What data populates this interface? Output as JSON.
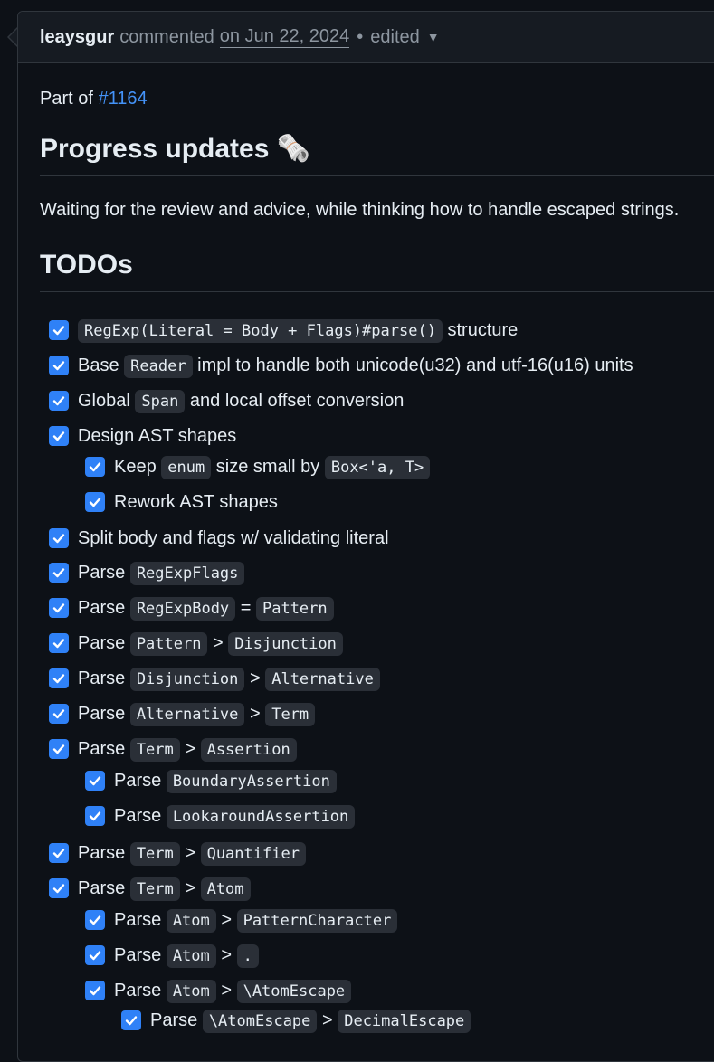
{
  "header": {
    "author": "leaysgur",
    "action": "commented",
    "date": "on Jun 22, 2024",
    "edited": "edited"
  },
  "intro": {
    "prefix": "Part of",
    "issue": "#1164"
  },
  "progress": {
    "heading": "Progress updates",
    "emoji": "🗞️",
    "text": "Waiting for the review and advice, while thinking how to handle escaped strings."
  },
  "todos_heading": "TODOs",
  "todos": [
    {
      "level": 0,
      "checked": true,
      "parts": [
        {
          "c": "RegExp(Literal = Body + Flags)#parse()"
        },
        {
          "t": "structure"
        }
      ]
    },
    {
      "level": 0,
      "checked": true,
      "parts": [
        {
          "t": "Base"
        },
        {
          "c": "Reader"
        },
        {
          "t": "impl to handle both unicode(u32) and utf-16(u16) units"
        }
      ]
    },
    {
      "level": 0,
      "checked": true,
      "parts": [
        {
          "t": "Global"
        },
        {
          "c": "Span"
        },
        {
          "t": "and local offset conversion"
        }
      ]
    },
    {
      "level": 0,
      "checked": true,
      "parts": [
        {
          "t": "Design AST shapes"
        }
      ]
    },
    {
      "level": 1,
      "checked": true,
      "parts": [
        {
          "t": "Keep"
        },
        {
          "c": "enum"
        },
        {
          "t": "size small by"
        },
        {
          "c": "Box<'a, T>"
        }
      ]
    },
    {
      "level": 1,
      "checked": true,
      "parts": [
        {
          "t": "Rework AST shapes"
        }
      ]
    },
    {
      "level": 0,
      "checked": true,
      "parts": [
        {
          "t": "Split body and flags w/ validating literal"
        }
      ]
    },
    {
      "level": 0,
      "checked": true,
      "parts": [
        {
          "t": "Parse"
        },
        {
          "c": "RegExpFlags"
        }
      ]
    },
    {
      "level": 0,
      "checked": true,
      "parts": [
        {
          "t": "Parse"
        },
        {
          "c": "RegExpBody"
        },
        {
          "t": "="
        },
        {
          "c": "Pattern"
        }
      ]
    },
    {
      "level": 0,
      "checked": true,
      "parts": [
        {
          "t": "Parse"
        },
        {
          "c": "Pattern"
        },
        {
          "t": ">"
        },
        {
          "c": "Disjunction"
        }
      ]
    },
    {
      "level": 0,
      "checked": true,
      "parts": [
        {
          "t": "Parse"
        },
        {
          "c": "Disjunction"
        },
        {
          "t": ">"
        },
        {
          "c": "Alternative"
        }
      ]
    },
    {
      "level": 0,
      "checked": true,
      "parts": [
        {
          "t": "Parse"
        },
        {
          "c": "Alternative"
        },
        {
          "t": ">"
        },
        {
          "c": "Term"
        }
      ]
    },
    {
      "level": 0,
      "checked": true,
      "parts": [
        {
          "t": "Parse"
        },
        {
          "c": "Term"
        },
        {
          "t": ">"
        },
        {
          "c": "Assertion"
        }
      ]
    },
    {
      "level": 1,
      "checked": true,
      "parts": [
        {
          "t": "Parse"
        },
        {
          "c": "BoundaryAssertion"
        }
      ]
    },
    {
      "level": 1,
      "checked": true,
      "parts": [
        {
          "t": "Parse"
        },
        {
          "c": "LookaroundAssertion"
        }
      ]
    },
    {
      "level": 0,
      "checked": true,
      "parts": [
        {
          "t": "Parse"
        },
        {
          "c": "Term"
        },
        {
          "t": ">"
        },
        {
          "c": "Quantifier"
        }
      ]
    },
    {
      "level": 0,
      "checked": true,
      "parts": [
        {
          "t": "Parse"
        },
        {
          "c": "Term"
        },
        {
          "t": ">"
        },
        {
          "c": "Atom"
        }
      ]
    },
    {
      "level": 1,
      "checked": true,
      "parts": [
        {
          "t": "Parse"
        },
        {
          "c": "Atom"
        },
        {
          "t": ">"
        },
        {
          "c": "PatternCharacter"
        }
      ]
    },
    {
      "level": 1,
      "checked": true,
      "parts": [
        {
          "t": "Parse"
        },
        {
          "c": "Atom"
        },
        {
          "t": ">"
        },
        {
          "c": "."
        }
      ]
    },
    {
      "level": 1,
      "checked": true,
      "parts": [
        {
          "t": "Parse"
        },
        {
          "c": "Atom"
        },
        {
          "t": ">"
        },
        {
          "c": "\\AtomEscape"
        }
      ]
    },
    {
      "level": 2,
      "checked": true,
      "parts": [
        {
          "t": "Parse"
        },
        {
          "c": "\\AtomEscape"
        },
        {
          "t": ">"
        },
        {
          "c": "DecimalEscape"
        }
      ]
    }
  ],
  "colors": {
    "accent": "#2f81f7",
    "link": "#4493f8",
    "background": "#0d1117"
  }
}
